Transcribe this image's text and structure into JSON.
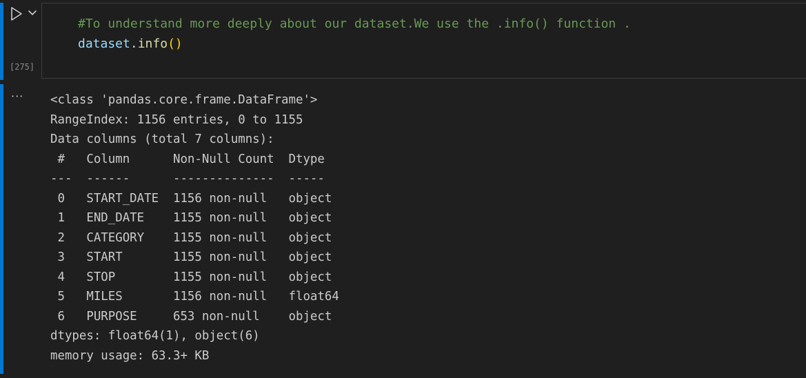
{
  "code_cell": {
    "execution_count": "[275]",
    "comment_line": "#To understand more deeply about our dataset.We use the .info() function .",
    "code_tokens": {
      "object": "dataset",
      "dot": ".",
      "method": "info",
      "parens": "()"
    }
  },
  "output_cell": {
    "more_label": "···",
    "lines": [
      "<class 'pandas.core.frame.DataFrame'>",
      "RangeIndex: 1156 entries, 0 to 1155",
      "Data columns (total 7 columns):",
      " #   Column      Non-Null Count  Dtype  ",
      "---  ------      --------------  -----  ",
      " 0   START_DATE  1156 non-null   object ",
      " 1   END_DATE    1155 non-null   object ",
      " 2   CATEGORY    1155 non-null   object ",
      " 3   START       1155 non-null   object ",
      " 4   STOP        1155 non-null   object ",
      " 5   MILES       1156 non-null   float64",
      " 6   PURPOSE     653 non-null    object ",
      "dtypes: float64(1), object(6)",
      "memory usage: 63.3+ KB"
    ]
  },
  "colors": {
    "background": "#1f1f1f",
    "cell_accent": "#0078d4",
    "comment": "#6a9955",
    "variable": "#9cdcfe",
    "function": "#dcdcaa",
    "bracket": "#ffd700",
    "output_text": "#cccccc"
  },
  "icons": {
    "run": "play-icon",
    "run_options": "chevron-down-icon",
    "output_actions": "more-icon"
  }
}
